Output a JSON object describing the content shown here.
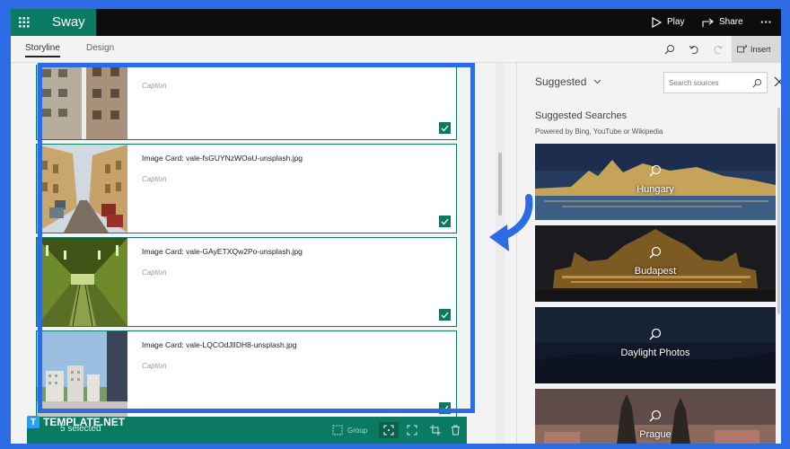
{
  "app": {
    "name": "Sway"
  },
  "topbar": {
    "play": "Play",
    "share": "Share",
    "more": "···"
  },
  "tabs": [
    {
      "label": "Storyline"
    },
    {
      "label": "Design"
    }
  ],
  "toolbar": {
    "insert": "Insert"
  },
  "cards": [
    {
      "title": "",
      "caption": "Caption"
    },
    {
      "title": "Image Card: vale-fsGUYNzWOaU-unsplash.jpg",
      "caption": "Caption"
    },
    {
      "title": "Image Card: vale-GAyETXQw2Po-unsplash.jpg",
      "caption": "Caption"
    },
    {
      "title": "Image Card: vale-LQCOdJlIDH8-unsplash.jpg",
      "caption": "Caption"
    }
  ],
  "selection": {
    "count": "5 selected",
    "group": "Group"
  },
  "watermark": {
    "text": "TEMPLATE.NET",
    "logo": "T"
  },
  "suggested": {
    "header": "Suggested",
    "search_placeholder": "Search sources",
    "title": "Suggested Searches",
    "powered": "Powered by Bing, YouTube or Wikipedia",
    "tiles": [
      {
        "label": "Hungary"
      },
      {
        "label": "Budapest"
      },
      {
        "label": "Daylight Photos"
      },
      {
        "label": "Prague"
      }
    ]
  },
  "colors": {
    "accent": "#0b7a63",
    "highlight": "#2d6be4"
  }
}
